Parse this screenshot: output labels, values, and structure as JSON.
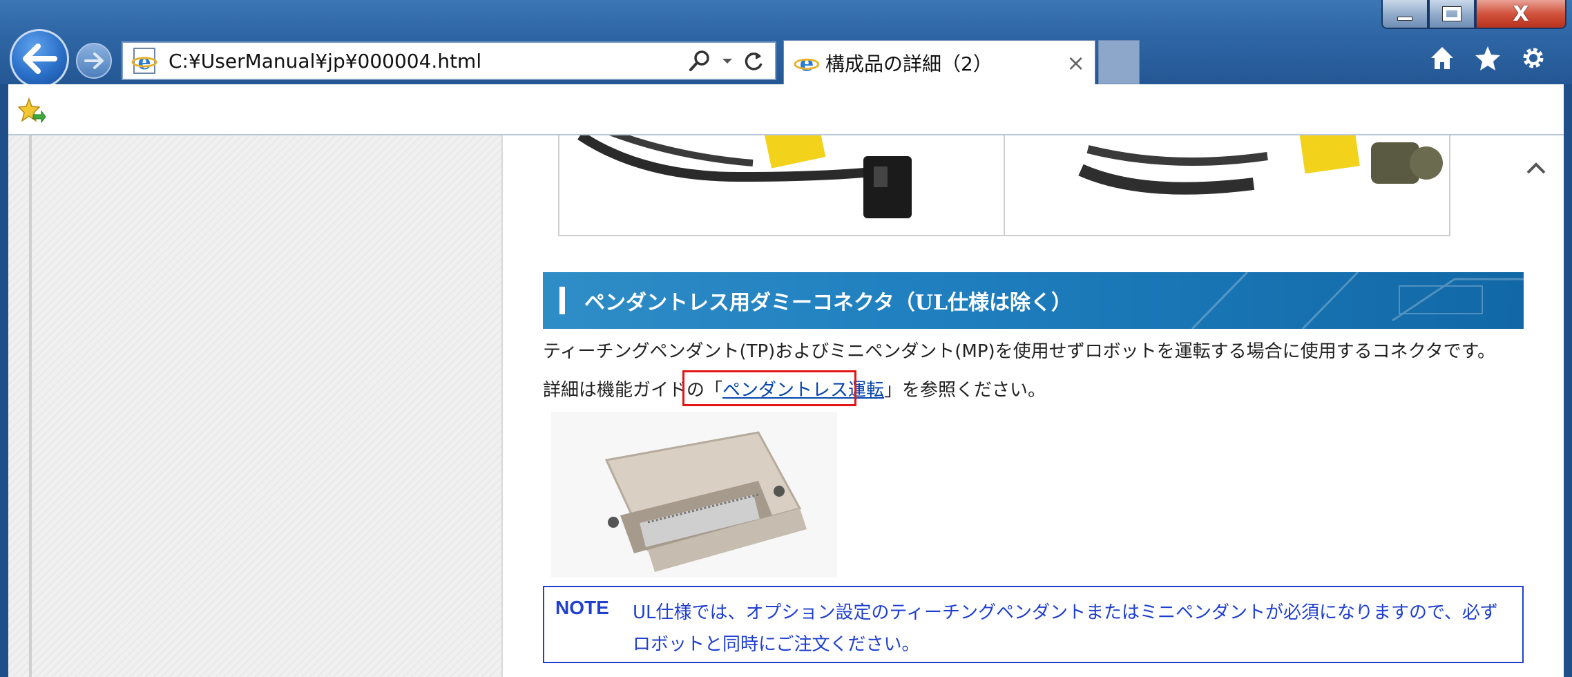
{
  "window": {
    "minimize_label": "",
    "close_glyph": "X"
  },
  "address_bar": {
    "url": "C:¥UserManual¥jp¥000004.html"
  },
  "tab": {
    "title": "構成品の詳細（2）",
    "close_glyph": "×"
  },
  "content": {
    "section_title": "ペンダントレス用ダミーコネクタ（UL仕様は除く）",
    "paragraph1": "ティーチングペンダント(TP)およびミニペンダント(MP)を使用せずロボットを運転する場合に使用するコネクタです。",
    "paragraph2_prefix": "詳細は機能ガイドの「",
    "paragraph2_link": "ペンダントレス運転",
    "paragraph2_suffix": "」を参照ください。",
    "note_label": "NOTE",
    "note_text": "UL仕様では、オプション設定のティーチングペンダントまたはミニペンダントが必須になりますので、必ずロボットと同時にご注文ください。"
  },
  "colors": {
    "section_header": "#1f7fbf",
    "note_border": "#1f3fcf",
    "highlight": "#e21616",
    "link": "#0645ad"
  }
}
